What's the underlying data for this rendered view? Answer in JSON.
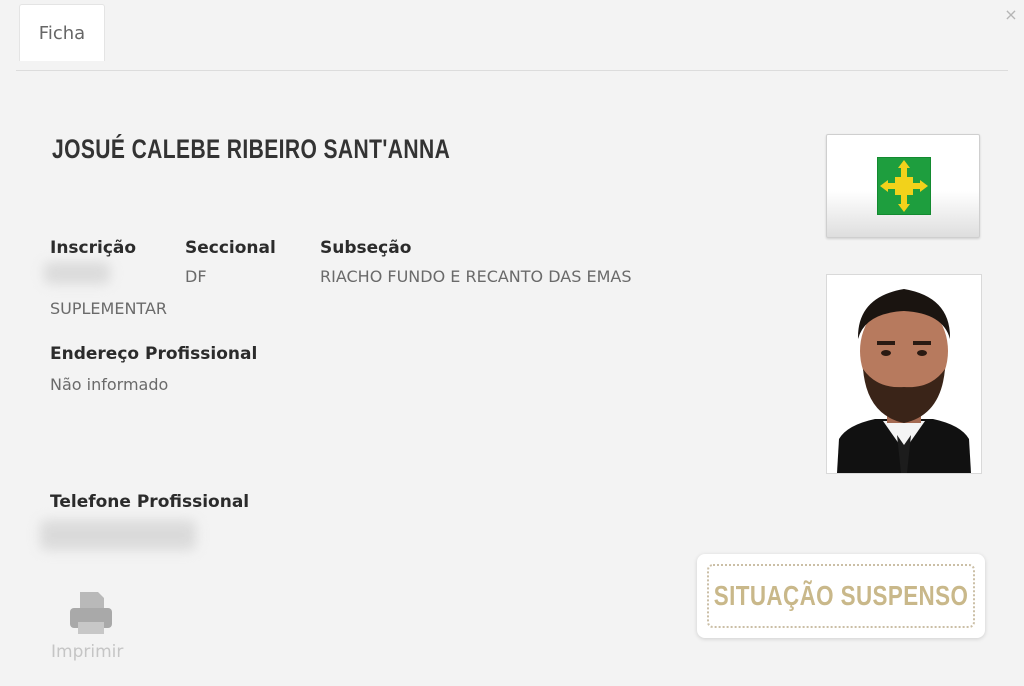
{
  "tabs": [
    {
      "label": "Ficha",
      "active": true
    }
  ],
  "close_icon": "close-icon",
  "profile": {
    "name": "JOSUÉ CALEBE RIBEIRO SANT'ANNA",
    "inscricao": {
      "label": "Inscrição",
      "value": ""
    },
    "seccional": {
      "label": "Seccional",
      "value": "DF"
    },
    "subsecao": {
      "label": "Subseção",
      "value": "RIACHO FUNDO E RECANTO DAS EMAS"
    },
    "tipo": "SUPLEMENTAR",
    "endereco": {
      "label": "Endereço Profissional",
      "value": "Não informado"
    },
    "telefone": {
      "label": "Telefone Profissional",
      "value": ""
    }
  },
  "flag_icon": "df-flag-icon",
  "actions": {
    "print_label": "Imprimir",
    "print_icon": "printer-icon"
  },
  "status": {
    "text": "SITUAÇÃO SUSPENSO"
  },
  "colors": {
    "accent_status": "#c9b88a",
    "flag_green": "#1e9e3e",
    "flag_yellow": "#f2d21b"
  }
}
